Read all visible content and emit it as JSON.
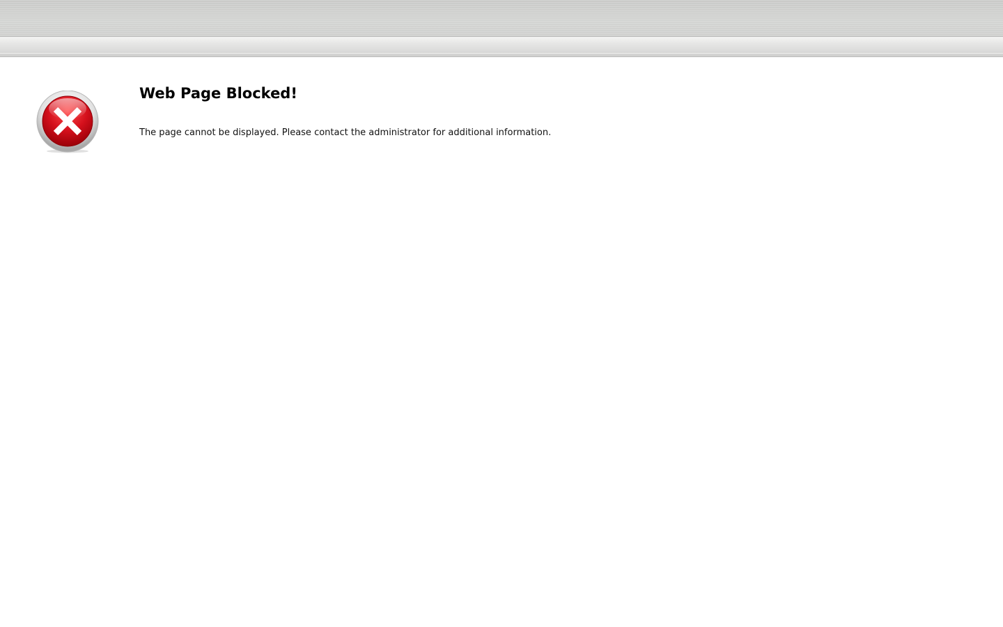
{
  "page": {
    "title": "Web Page Blocked!",
    "message": "The page cannot be displayed. Please contact the administrator for additional information."
  },
  "icon": {
    "name": "error-x-icon",
    "color": "#d4101c"
  },
  "colors": {
    "header_gray": "#cfd0ce",
    "background": "#ffffff",
    "text": "#000000"
  }
}
